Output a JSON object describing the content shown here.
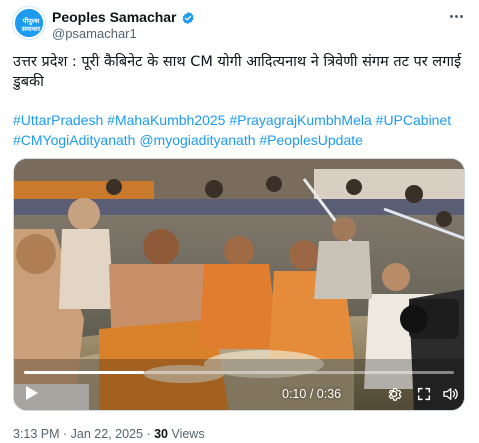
{
  "account": {
    "display_name": "Peoples Samachar",
    "handle": "@psamachar1",
    "avatar_text": "पीपुल्स समाचार",
    "verified": true
  },
  "tweet": {
    "text": "उत्तर प्रदेश : पूरी कैबिनेट के साथ CM योगी आदित्यनाथ ने त्रिवेणी संगम तट पर लगाई डुबकी",
    "hashtags_line1": "#UttarPradesh #MahaKumbh2025 #PrayagrajKumbhMela #UPCabinet",
    "hashtags_line2": "#CMYogiAdityanath @myogiadityanath #PeoplesUpdate"
  },
  "video": {
    "current_time": "0:10",
    "separator": " / ",
    "duration": "0:36",
    "progress_fraction": 0.28
  },
  "meta": {
    "time": "3:13 PM",
    "dot1": " · ",
    "date": "Jan 22, 2025",
    "dot2": " · ",
    "views_count": "30",
    "views_label": " Views"
  },
  "icons": {
    "more": "more-horizontal-icon",
    "verified": "verified-badge-icon",
    "play": "play-icon",
    "settings": "gear-icon",
    "fullscreen": "expand-icon",
    "sound": "speaker-icon"
  },
  "colors": {
    "link": "#1d9bf0",
    "verified": "#1d9bf0",
    "secondary_text": "#536471",
    "saffron_robes": "#d9822b"
  }
}
